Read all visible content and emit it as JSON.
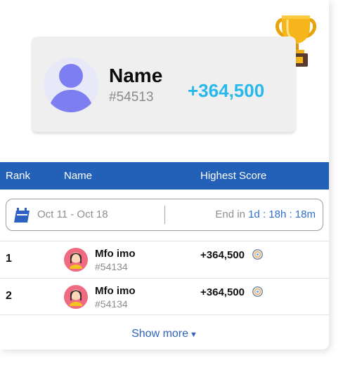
{
  "winner": {
    "name": "Name",
    "id": "#54513",
    "score": "+364,500",
    "score_color": "#27b8ec",
    "icon": "trophy-icon"
  },
  "table": {
    "headers": [
      "Rank",
      "Name",
      "Highest Score"
    ],
    "header_bg": "#2361b8",
    "date_range": "Oct 11 - Oct 18",
    "end_label": "End in",
    "end_value": "1d : 18h : 18m",
    "rows": [
      {
        "rank": "1",
        "name": "Mfo imo",
        "id": "#54134",
        "score": "+364,500"
      },
      {
        "rank": "2",
        "name": "Mfo imo",
        "id": "#54134",
        "score": "+364,500"
      }
    ],
    "show_more": "Show more"
  }
}
